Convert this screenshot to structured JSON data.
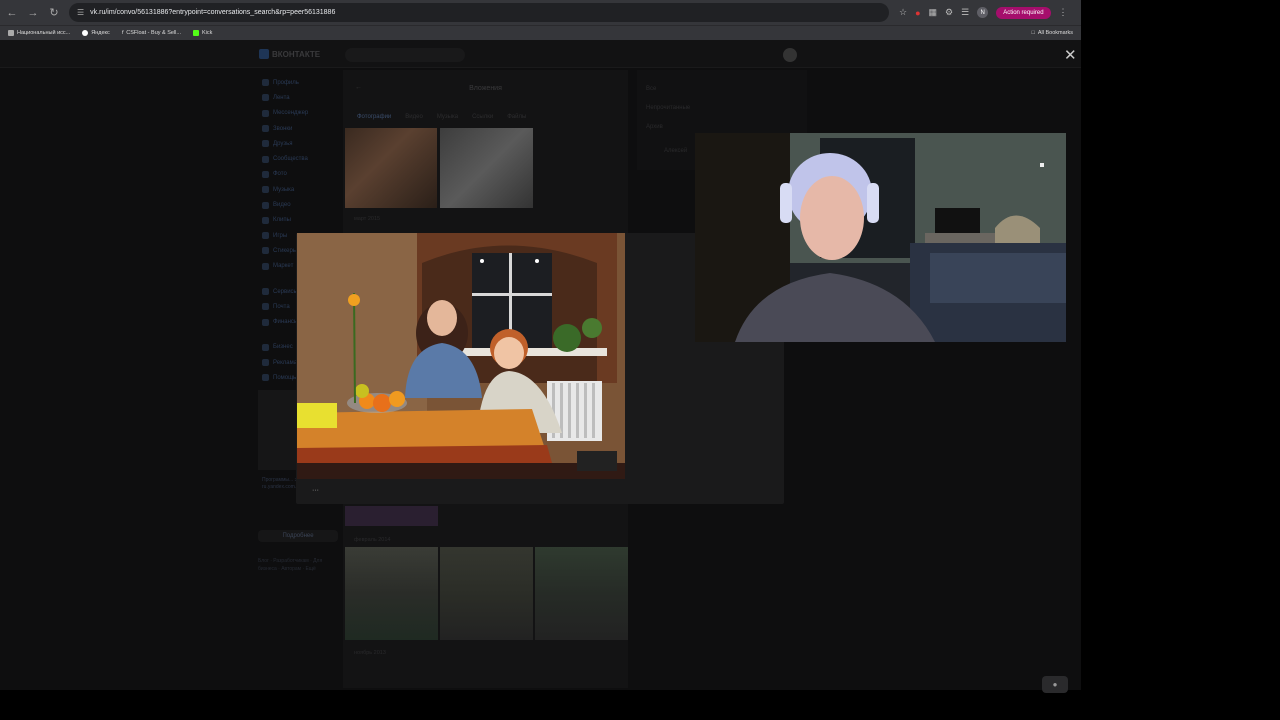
{
  "browser": {
    "url": "vk.ru/im/convo/56131886?entrypoint=conversations_search&rp=peer56131886",
    "action_required": "Action required",
    "profile_initial": "N",
    "bookmarks": [
      "Национальный исс...",
      "Яндекс",
      "CSFloat - Buy & Sell...",
      "Kick"
    ],
    "all_bookmarks": "All Bookmarks"
  },
  "vk": {
    "logo": "ВКОНТАКТЕ",
    "sidebar": [
      "Профиль",
      "Лента",
      "Мессенджер",
      "Звонки",
      "Друзья",
      "Сообщества",
      "Фото",
      "Музыка",
      "Видео",
      "Клипы",
      "Игры",
      "Стикеры",
      "Маркет",
      "Сервисы",
      "Почта",
      "Финансы",
      "Бизнес",
      "Реклама",
      "Помощь"
    ],
    "ad_text": "Программы... экрана... ru.yandex.com...",
    "ad_more": "Подробнее",
    "footer": "Блог · Разработчикам · Для бизнеса · Авторам · Ещё",
    "attachments": {
      "title": "Вложения",
      "tabs": [
        "Фотографии",
        "Видео",
        "Музыка",
        "Ссылки",
        "Файлы"
      ],
      "dates": [
        "март 2015",
        "февраль 2014",
        "ноябрь 2013"
      ]
    },
    "right_panel": {
      "items": [
        "Все",
        "Непрочитанные",
        "Архив",
        "Алексей"
      ]
    }
  },
  "viewer": {
    "more": "···"
  },
  "colors": {
    "accent": "#a50e6c",
    "vk_blue": "#2a3a55"
  }
}
